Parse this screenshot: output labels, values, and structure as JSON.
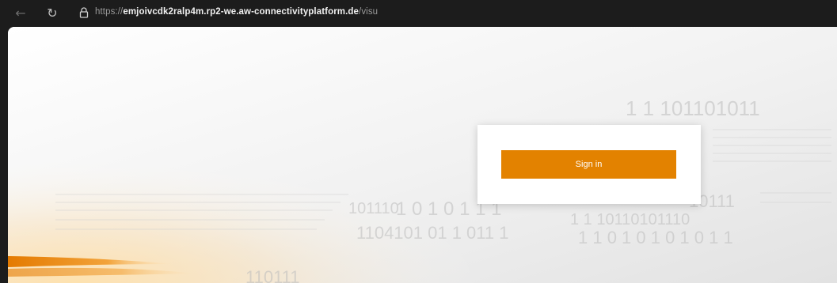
{
  "browser": {
    "back_icon": "back-arrow-icon",
    "reload_icon": "reload-icon",
    "lock_icon": "lock-icon",
    "url_scheme": "https://",
    "url_host": "emjoivcdk2ralp4m.rp2-we.aw-connectivityplatform.de",
    "url_path": "/visu"
  },
  "login": {
    "signin_label": "Sign in",
    "accent": "#e38200"
  },
  "background": {
    "binary_lines": [
      "1 1 101101011",
      "1 0 1 0 1 1 1",
      "1 1 10110101110",
      "1 1 0 1 0 1 0 1 0 1 1",
      "10111",
      "101110",
      "1104101 01 1 011 1",
      "110111"
    ]
  }
}
